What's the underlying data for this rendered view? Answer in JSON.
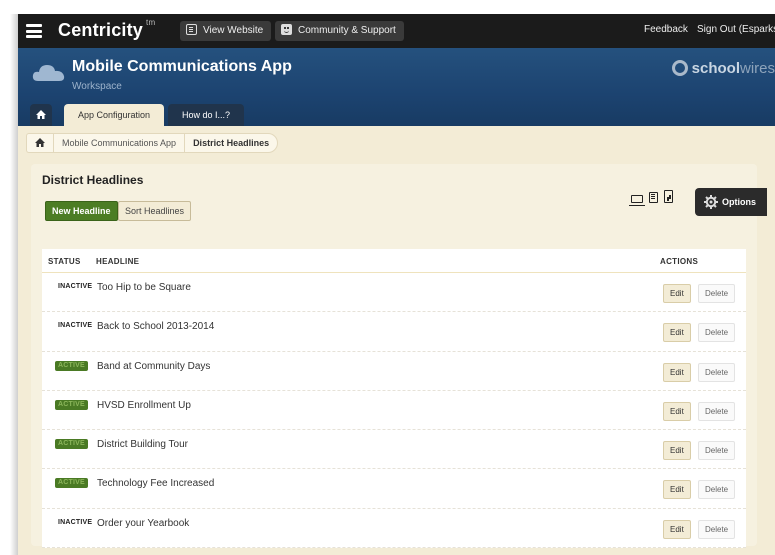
{
  "topbar": {
    "brand": "Centricity",
    "brand_mark": "tm",
    "view_website": "View Website",
    "community_support": "Community & Support",
    "feedback": "Feedback",
    "sign_out": "Sign Out (Esparks)"
  },
  "header": {
    "title": "Mobile Communications App",
    "subtitle": "Workspace",
    "logo_bold": "school",
    "logo_light": "wires",
    "tabs": [
      {
        "label": "App Configuration",
        "active": true
      },
      {
        "label": "How do I...?",
        "active": false
      }
    ]
  },
  "breadcrumb": {
    "items": [
      "Mobile Communications App",
      "District Headlines"
    ]
  },
  "panel": {
    "title": "District Headlines",
    "new_button": "New Headline",
    "sort_button": "Sort Headlines",
    "options_label": "Options",
    "columns": {
      "status": "STATUS",
      "headline": "HEADLINE",
      "actions": "ACTIONS"
    },
    "rows": [
      {
        "status": "INACTIVE",
        "headline": "Too Hip to be Square"
      },
      {
        "status": "INACTIVE",
        "headline": "Back to School 2013-2014"
      },
      {
        "status": "ACTIVE",
        "headline": "Band at Community Days"
      },
      {
        "status": "ACTIVE",
        "headline": "HVSD Enrollment Up"
      },
      {
        "status": "ACTIVE",
        "headline": "District Building Tour"
      },
      {
        "status": "ACTIVE",
        "headline": "Technology Fee Increased"
      },
      {
        "status": "INACTIVE",
        "headline": "Order your Yearbook"
      }
    ],
    "edit_label": "Edit",
    "delete_label": "Delete"
  },
  "colors": {
    "topbar": "#1b1b1b",
    "header_blue": "#1c4370",
    "cream": "#f3ecd6",
    "green": "#4c7d24"
  }
}
